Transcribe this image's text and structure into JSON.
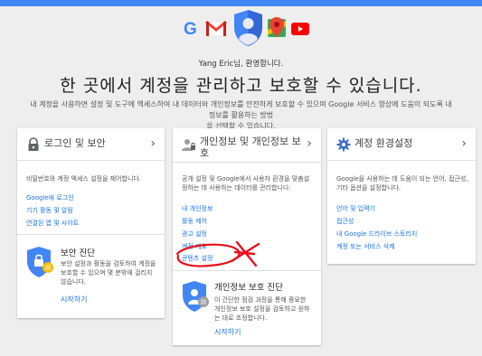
{
  "header": {
    "accent_color": "#4285f4",
    "apps": [
      {
        "icon": "google-g-icon"
      },
      {
        "icon": "gmail-icon"
      },
      {
        "icon": "account-shield-avatar-icon"
      },
      {
        "icon": "maps-icon"
      },
      {
        "icon": "youtube-icon"
      }
    ],
    "g_letter": "G"
  },
  "greeting": "Yang Eric님, 환영합니다.",
  "headline": "한 곳에서 계정을 관리하고 보호할 수 있습니다.",
  "description_line1": "내 계정을 사용하면 설정 및 도구에 액세스하여 내 데이터와 개인정보를 안전하게 보호할 수 있으며 Google 서비스 향상에 도움이 되도록 내 정보를 활용하는 방법",
  "description_line2": "을 선택할 수 있습니다.",
  "cards": [
    {
      "icon": "lock-icon",
      "title": "로그인 및 보안",
      "desc_line1": "비밀번호와 계정 액세스 설정을 제어합니다.",
      "links": [
        "Google에 로그인",
        "기기 활동 및 알림",
        "연결된 앱 및 사이트"
      ],
      "sub": {
        "icon": "security-checkup-shield-icon",
        "title": "보안 진단",
        "desc_line1": "보안 설정과 활동을 검토하여 계정을",
        "desc_line2": "보호할 수 있으며 몇 분밖에 걸리지",
        "desc_line3": "않습니다.",
        "action": "시작하기"
      }
    },
    {
      "icon": "person-lock-icon",
      "title_line1": "개인정보 및 개인정보 보",
      "title_line2": "호",
      "desc_line1": "공개 설정 및 Google에서 사용자 환경을 맞춤설",
      "desc_line2": "정하는 데 사용하는 데이터를 관리합니다.",
      "links": [
        "내 개인정보",
        "활동 제어",
        "광고 설정",
        "계정 개요",
        "콘텐츠 설정"
      ],
      "sub": {
        "icon": "privacy-checkup-shield-icon",
        "title": "개인정보 보호 진단",
        "desc_line1": "이 간단한 점검 과정을 통해 중요한",
        "desc_line2": "개인정보 보호 설정을 검토하고 원하",
        "desc_line3": "는 대로 조정합니다.",
        "action": "시작하기"
      }
    },
    {
      "icon": "gear-icon",
      "title": "계정 환경설정",
      "desc_line1": "Google을 사용하는 데 도움이 되는 언어, 접근성,",
      "desc_line2": "기타 옵션을 설정합니다.",
      "links": [
        "언어 및 입력기",
        "접근성",
        "내 Google 드라이브 스토리지",
        "계정 또는 서비스 삭제"
      ]
    }
  ],
  "annotation": {
    "color": "#e8101a"
  }
}
